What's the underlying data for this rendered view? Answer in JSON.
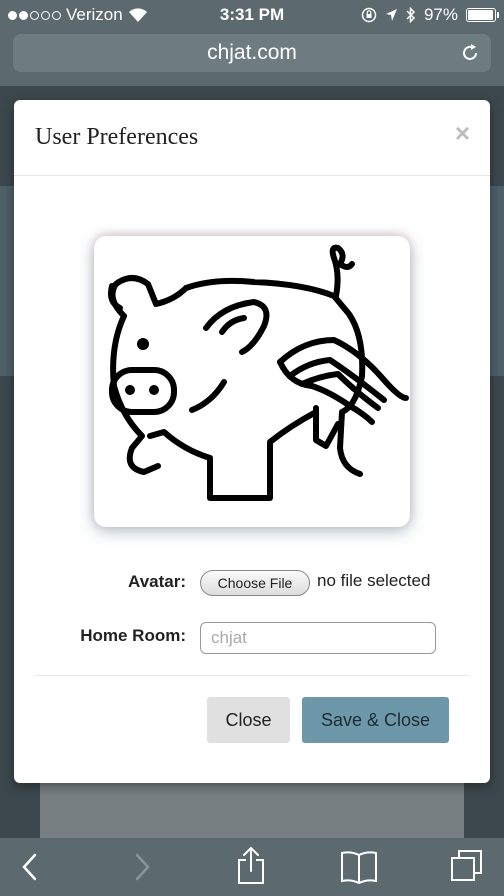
{
  "status_bar": {
    "carrier": "Verizon",
    "time": "3:31 PM",
    "battery": "97%",
    "battery_level": 0.97,
    "signal_dots_filled": 2,
    "signal_dots_total": 5
  },
  "browser": {
    "url": "chjat.com"
  },
  "modal": {
    "title": "User Preferences",
    "close_symbol": "×",
    "avatar_label": "Avatar:",
    "choose_file_label": "Choose File",
    "file_status": "no file selected",
    "home_room_label": "Home Room:",
    "home_room_placeholder": "chjat",
    "close_button": "Close",
    "save_button": "Save & Close"
  },
  "colors": {
    "accent": "#6d98a9",
    "chrome": "#5c6a70"
  },
  "icons": [
    "wifi-icon",
    "lock-rotation-icon",
    "location-icon",
    "bluetooth-icon",
    "battery-icon",
    "reload-icon",
    "back-icon",
    "forward-icon",
    "share-icon",
    "bookmarks-icon",
    "tabs-icon"
  ]
}
